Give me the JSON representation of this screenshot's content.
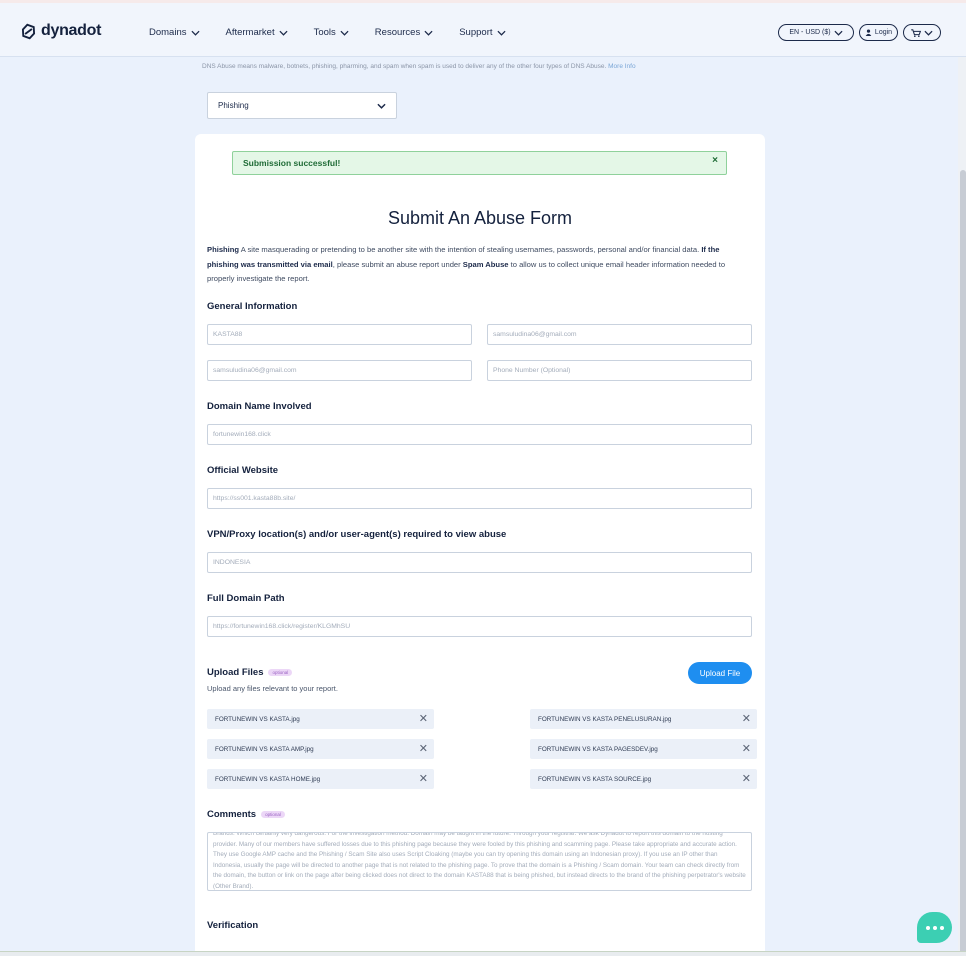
{
  "header": {
    "logo_text": "dynadot",
    "nav": [
      {
        "label": "Domains"
      },
      {
        "label": "Aftermarket"
      },
      {
        "label": "Tools"
      },
      {
        "label": "Resources"
      },
      {
        "label": "Support"
      }
    ],
    "lang_label": "EN - USD ($)",
    "login_label": "Login"
  },
  "intro": {
    "dns_note": "DNS Abuse means malware, botnets, phishing, pharming, and spam when spam is used to deliver any of the other four types of DNS Abuse.",
    "more_info": "More Info"
  },
  "abuse_type": {
    "selected": "Phishing"
  },
  "alert": {
    "message": "Submission successful!",
    "close": "×"
  },
  "form": {
    "title": "Submit An Abuse Form",
    "desc_term": "Phishing",
    "desc_1": " A site masquerading or pretending to be another site with the intention of stealing usernames, passwords, personal and/or financial data.",
    "desc_bold": " If the phishing was transmitted via email",
    "desc_2": ", please submit an abuse report under ",
    "desc_bold2": "Spam Abuse",
    "desc_3": " to allow us to collect unique email header information needed to properly investigate the report.",
    "general": {
      "heading": "General Information",
      "name": "KASTA88",
      "email": "samsuludina06@gmail.com",
      "email_confirm": "samsuludina06@gmail.com",
      "phone_placeholder": "Phone Number (Optional)"
    },
    "domain": {
      "heading": "Domain Name Involved",
      "value": "fortunewin168.click"
    },
    "official": {
      "heading": "Official Website",
      "value": "https://ss001.kasta88b.site/"
    },
    "vpn": {
      "heading": "VPN/Proxy location(s) and/or user-agent(s) required to view abuse",
      "value": "INDONESIA"
    },
    "path": {
      "heading": "Full Domain Path",
      "value": "https://fortunewin168.click/register/KLGMhSU"
    },
    "upload": {
      "heading": "Upload Files",
      "optional": "optional",
      "sub": "Upload any files relevant to your report.",
      "button": "Upload File",
      "files": [
        "FORTUNEWIN VS KASTA.jpg",
        "FORTUNEWIN VS KASTA PENELUSURAN.jpg",
        "FORTUNEWIN VS KASTA AMP.jpg",
        "FORTUNEWIN VS KASTA PAGESDEV.jpg",
        "FORTUNEWIN VS KASTA HOME.jpg",
        "FORTUNEWIN VS KASTA SOURCE.jpg"
      ]
    },
    "comments": {
      "heading": "Comments",
      "optional": "optional",
      "text": "Brands. Which certainly very dangerous. For the investigation method. Domain may be taught in the future. Through your registrar. We ask Dynadot to report this domain to the hosting provider. Many of our members have suffered losses due to this phishing page because they were fooled by this phishing and scamming page. Please take appropriate and accurate action. They use Google AMP cache and the Phishing / Scam Site also uses Script Cloaking (maybe you can try opening this domain using an Indonesian proxy). If you use an IP other than Indonesia, usually the page will be directed to another page that is not related to the phishing page. To prove that the domain is a Phishing / Scam domain. Your team can check directly from the domain, the button or link on the page after being clicked does not direct to the domain KASTA88 that is being phished, but instead directs to the brand of the phishing perpetrator's website (Other Brand)."
    },
    "verification": {
      "heading": "Verification"
    }
  },
  "colors": {
    "accent": "#1e8ef0",
    "success_bg": "#e4f7e7",
    "chat": "#3ccfb3"
  }
}
